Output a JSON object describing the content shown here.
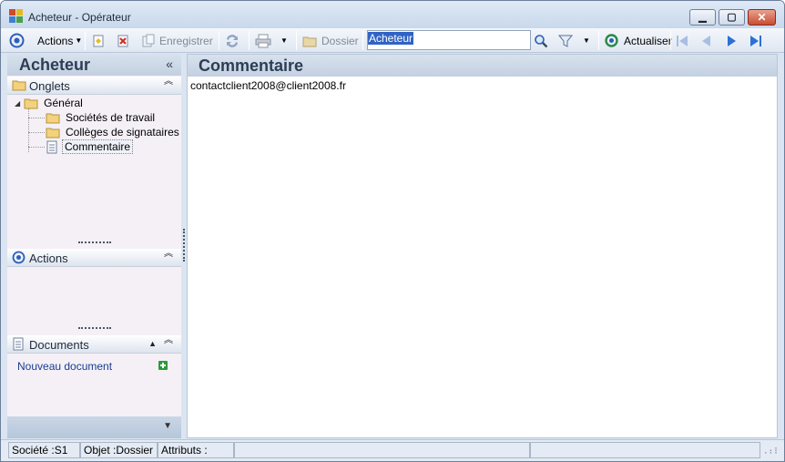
{
  "window": {
    "title": "Acheteur -  Opérateur",
    "min_glyph": "▁",
    "max_glyph": "▢",
    "close_glyph": "✕"
  },
  "toolbar": {
    "actions_label": "Actions",
    "save_label": "Enregistrer",
    "folder_label": "Dossier",
    "search_value": "Acheteur",
    "refresh_label": "Actualiser"
  },
  "left_panel": {
    "title": "Acheteur",
    "collapse_glyph": "«",
    "sections": {
      "tabs": "Onglets",
      "actions": "Actions",
      "documents": "Documents"
    },
    "tree": {
      "root": "Général",
      "children": [
        "Sociétés de travail",
        "Collèges de signataires",
        "Commentaire"
      ]
    },
    "new_document": "Nouveau document"
  },
  "main": {
    "title": "Commentaire",
    "content": "contactclient2008@client2008.fr"
  },
  "status": {
    "company": "Société :S1",
    "object": "Objet :Dossier",
    "attributes": "Attributs :"
  },
  "colors": {
    "accent": "#2d3d55",
    "selection": "#3163c5",
    "link": "#1a3d8f"
  }
}
